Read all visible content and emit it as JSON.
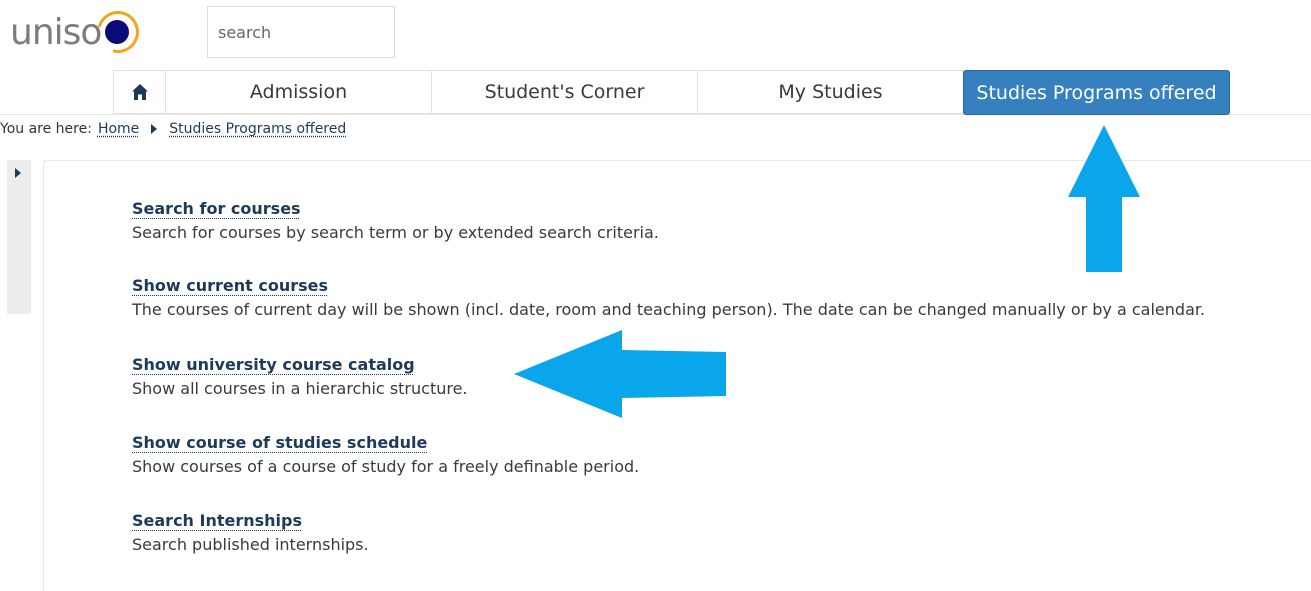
{
  "header": {
    "logo_text": "uniso",
    "search": {
      "placeholder": "search",
      "value": ""
    }
  },
  "nav": {
    "home_icon": "home-icon",
    "tabs": [
      {
        "label": "Admission"
      },
      {
        "label": "Student's Corner"
      },
      {
        "label": "My Studies"
      },
      {
        "label": "Studies Programs offered",
        "active": true
      }
    ]
  },
  "breadcrumb": {
    "prefix": "You are here:",
    "items": [
      "Home",
      "Studies Programs offered"
    ]
  },
  "entries": [
    {
      "title": "Search for courses",
      "description": "Search for courses by search term or by extended search criteria."
    },
    {
      "title": "Show current courses",
      "description": "The courses of current day will be shown (incl. date, room and teaching person). The date can be changed manually or by a calendar."
    },
    {
      "title": "Show university course catalog",
      "description": "Show all courses in a hierarchic structure."
    },
    {
      "title": "Show course of studies schedule",
      "description": "Show courses of a course of study for a freely definable period."
    },
    {
      "title": "Search Internships",
      "description": "Search published internships."
    }
  ],
  "colors": {
    "active_tab": "#3680c0",
    "link": "#1e3a5a",
    "logo_dot": "#0a0a78",
    "logo_ring": "#f5a21c",
    "annotation_arrow": "#0aa6ec"
  }
}
